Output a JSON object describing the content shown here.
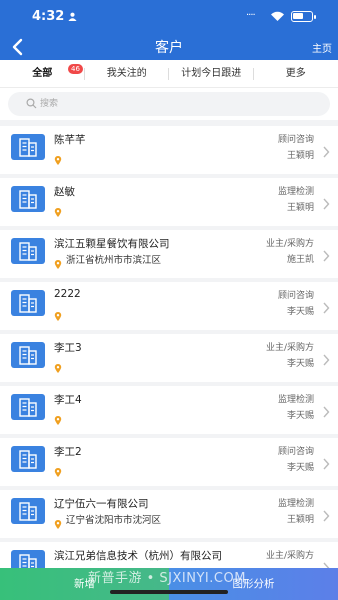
{
  "status": {
    "time": "4:32",
    "battery_level": 0.55
  },
  "nav": {
    "title": "客户",
    "right_label": "主页"
  },
  "tabs": [
    {
      "label": "全部",
      "badge": "46"
    },
    {
      "label": "我关注的"
    },
    {
      "label": "计划今日跟进"
    },
    {
      "label": "更多"
    }
  ],
  "search": {
    "placeholder": "搜索"
  },
  "customers": [
    {
      "name": "陈芊芊",
      "address": "",
      "type": "顾问咨询",
      "owner": "王颖明"
    },
    {
      "name": "赵敏",
      "address": "",
      "type": "监理检测",
      "owner": "王颖明"
    },
    {
      "name": "滨江五颗星餐饮有限公司",
      "address": "浙江省杭州市市滨江区",
      "type": "业主/采购方",
      "owner": "施王凯"
    },
    {
      "name": "2222",
      "address": "",
      "type": "顾问咨询",
      "owner": "李天赐"
    },
    {
      "name": "李工3",
      "address": "",
      "type": "业主/采购方",
      "owner": "李天赐"
    },
    {
      "name": "李工4",
      "address": "",
      "type": "监理检测",
      "owner": "李天赐"
    },
    {
      "name": "李工2",
      "address": "",
      "type": "顾问咨询",
      "owner": "李天赐"
    },
    {
      "name": "辽宁伍六一有限公司",
      "address": "辽宁省沈阳市市沈河区",
      "type": "监理检测",
      "owner": "王颖明"
    },
    {
      "name": "滨江兄弟信息技术（杭州）有限公司",
      "address": "",
      "type": "业主/采购方",
      "owner": ""
    }
  ],
  "bottom": {
    "add_label": "新增",
    "analysis_label": "图形分析"
  },
  "watermark": "新普手游 • SJXINYI.COM",
  "colors": {
    "primary": "#2a6fd6",
    "add": "#3cbf7e",
    "analysis": "#4f8ae6",
    "badge": "#f04848",
    "pin": "#f0a020"
  }
}
